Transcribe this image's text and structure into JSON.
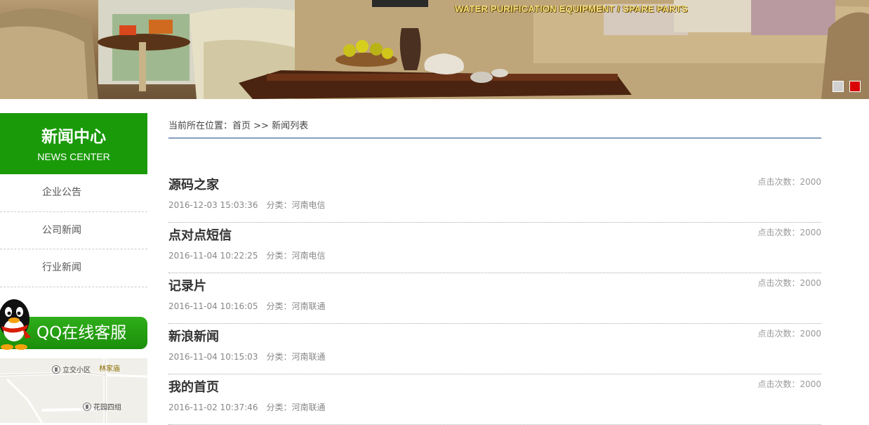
{
  "banner": {
    "caption": "WATER PURIFICATION EQUIPMENT / SPARE PARTS",
    "slides": [
      {
        "state": "inactive"
      },
      {
        "state": "active"
      }
    ]
  },
  "sidebar": {
    "title_cn": "新闻中心",
    "title_en": "NEWS CENTER",
    "items": [
      {
        "label": "企业公告"
      },
      {
        "label": "公司新闻"
      },
      {
        "label": "行业新闻"
      }
    ],
    "qq_label": "QQ在线客服",
    "map_labels": [
      {
        "text": "立交小区"
      },
      {
        "text": "林家庙"
      },
      {
        "text": "花园四组"
      }
    ]
  },
  "breadcrumb": {
    "prefix": "当前所在位置：",
    "home": "首页",
    "separator": " >> ",
    "current": "新闻列表"
  },
  "news": [
    {
      "title": "源码之家",
      "date": "2016-12-03 15:03:36",
      "category": "分类：河南电信",
      "hits": "点击次数：2000"
    },
    {
      "title": "点对点短信",
      "date": "2016-11-04 10:22:25",
      "category": "分类：河南电信",
      "hits": "点击次数：2000"
    },
    {
      "title": "记录片",
      "date": "2016-11-04 10:16:05",
      "category": "分类：河南联通",
      "hits": "点击次数：2000"
    },
    {
      "title": "新浪新闻",
      "date": "2016-11-04 10:15:03",
      "category": "分类：河南联通",
      "hits": "点击次数：2000"
    },
    {
      "title": "我的首页",
      "date": "2016-11-02 10:37:46",
      "category": "分类：河南联通",
      "hits": "点击次数：2000"
    }
  ],
  "colors": {
    "sidebar_green": "#1a9a09",
    "active_dot": "#d80000",
    "breadcrumb_rule": "#1e4a8a"
  }
}
